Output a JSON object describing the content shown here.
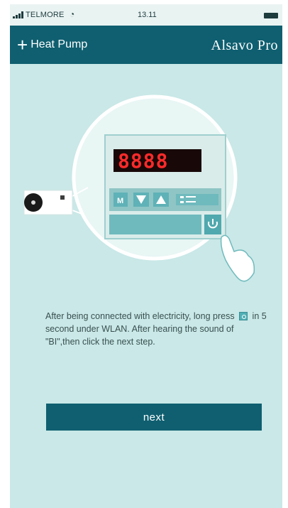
{
  "status_bar": {
    "carrier": "TELMORE",
    "time": "13.11"
  },
  "header": {
    "back_label": "Heat Pump",
    "brand": "Alsavo Pro"
  },
  "device": {
    "display_text": "8888",
    "mode_key": "M"
  },
  "instructions": {
    "part1": "After being connected with electricity, long press",
    "part2": "in 5 second under WLAN. After hearing the sound of \"BI\",then click the next step."
  },
  "next_label": "next",
  "colors": {
    "header_bg": "#0f5f70",
    "screen_bg": "#c9e8e7",
    "display_text": "#ff2a2a",
    "button_bg": "#0f5f70"
  },
  "icons": [
    "plus-icon",
    "wifi-icon",
    "battery-icon",
    "down-arrow-icon",
    "up-arrow-icon",
    "power-icon",
    "hand-pointer-icon"
  ]
}
